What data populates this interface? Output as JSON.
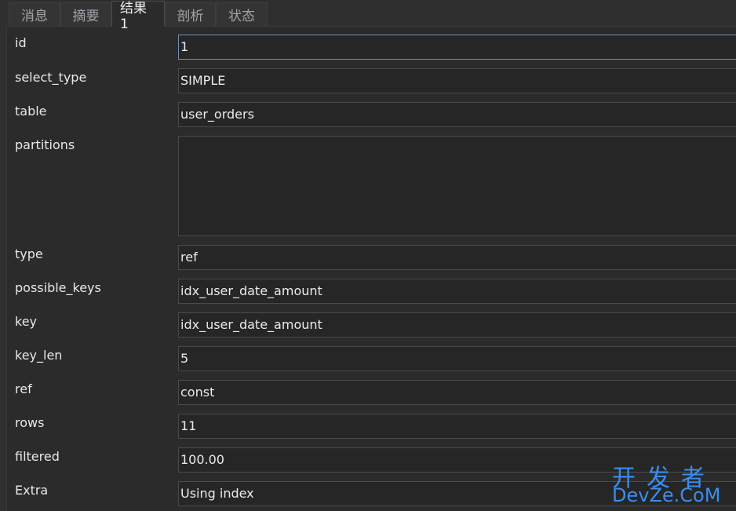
{
  "tabs": [
    {
      "label": "消息"
    },
    {
      "label": "摘要"
    },
    {
      "label": "结果 1"
    },
    {
      "label": "剖析"
    },
    {
      "label": "状态"
    }
  ],
  "active_tab": "结果 1",
  "rows": [
    {
      "label": "id",
      "value": "1"
    },
    {
      "label": "select_type",
      "value": "SIMPLE"
    },
    {
      "label": "table",
      "value": "user_orders"
    },
    {
      "label": "partitions",
      "value": ""
    },
    {
      "label": "type",
      "value": "ref"
    },
    {
      "label": "possible_keys",
      "value": "idx_user_date_amount"
    },
    {
      "label": "key",
      "value": "idx_user_date_amount"
    },
    {
      "label": "key_len",
      "value": "5"
    },
    {
      "label": "ref",
      "value": "const"
    },
    {
      "label": "rows",
      "value": "11"
    },
    {
      "label": "filtered",
      "value": "100.00"
    },
    {
      "label": "Extra",
      "value": "Using index"
    }
  ],
  "watermark": {
    "line1": "开发者",
    "line2": "DevZe.CoM"
  }
}
